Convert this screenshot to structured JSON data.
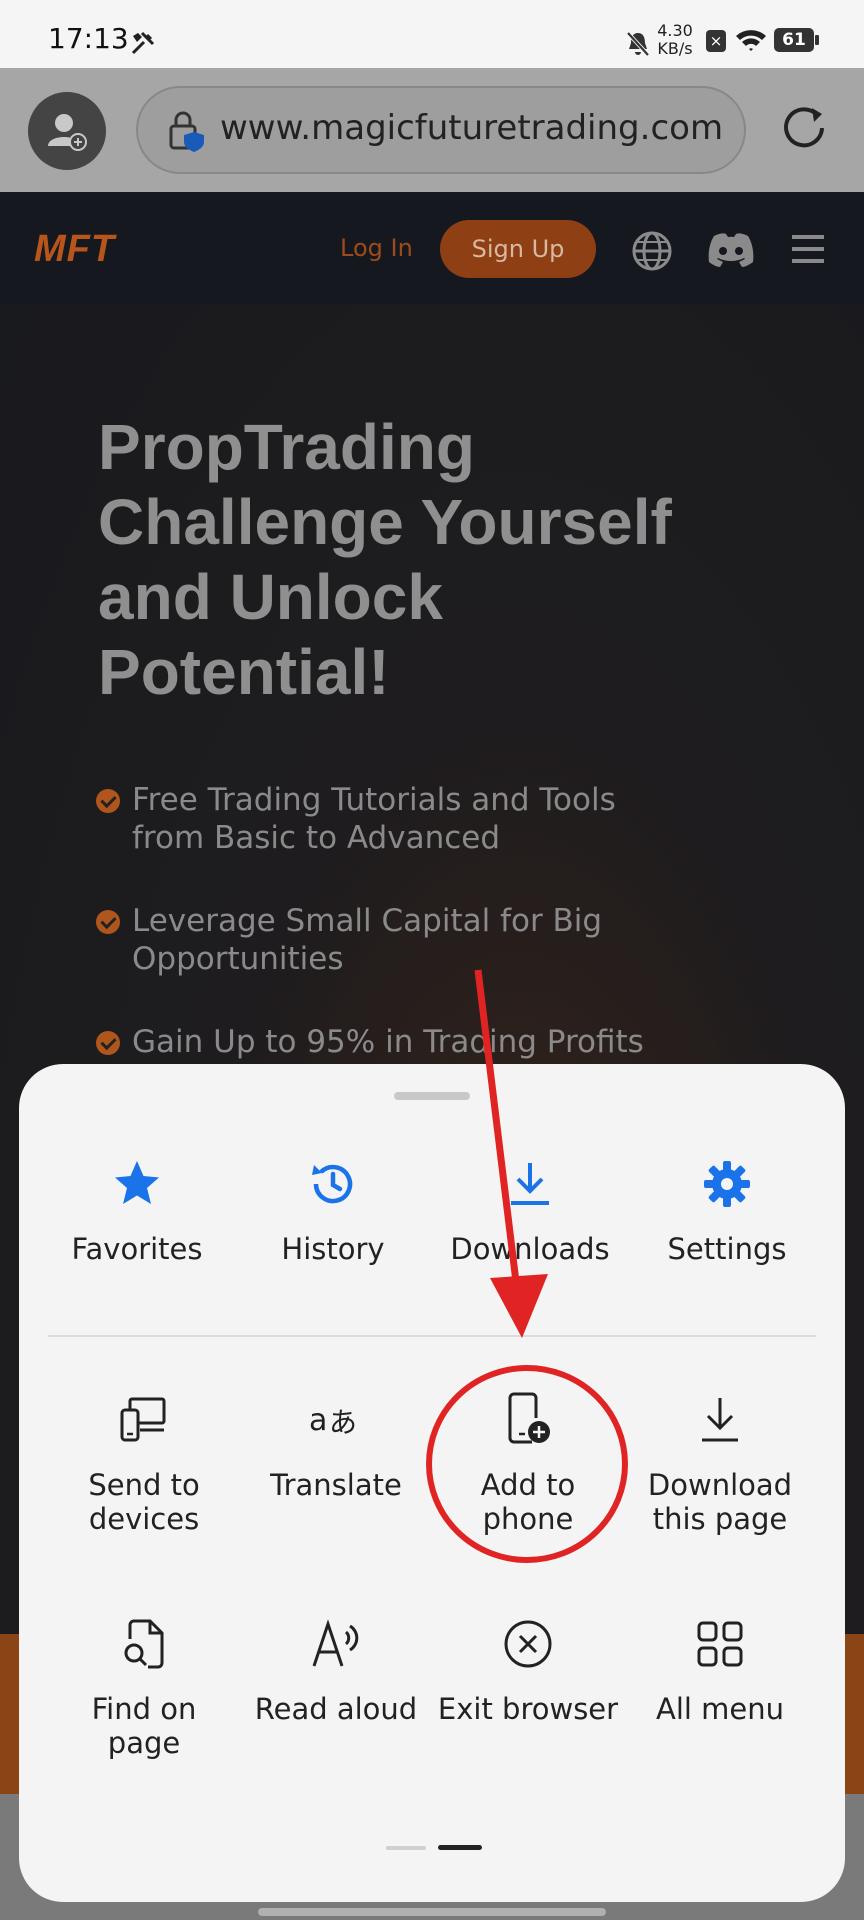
{
  "status_bar": {
    "time": "17:13",
    "net_speed_value": "4.30",
    "net_speed_unit": "KB/s",
    "battery": "61"
  },
  "browser": {
    "url": "www.magicfuturetrading.com"
  },
  "site": {
    "logo": "MFT",
    "login_label": "Log In",
    "signup_label": "Sign Up",
    "headline": [
      "PropTrading",
      "Challenge Yourself",
      "and Unlock",
      "Potential!"
    ],
    "bullets": [
      [
        "Free Trading Tutorials and Tools",
        "from Basic to Advanced"
      ],
      [
        "Leverage Small Capital for Big",
        "Opportunities"
      ],
      [
        "Gain Up to 95% in Trading Profits"
      ]
    ]
  },
  "menu": {
    "quick_actions": [
      {
        "label": "Favorites",
        "icon": "star-icon"
      },
      {
        "label": "History",
        "icon": "history-icon"
      },
      {
        "label": "Downloads",
        "icon": "download-icon"
      },
      {
        "label": "Settings",
        "icon": "gear-icon"
      }
    ],
    "items": [
      {
        "label": [
          "Send to",
          "devices"
        ],
        "icon": "send-to-devices-icon"
      },
      {
        "label": [
          "Translate"
        ],
        "icon": "translate-icon"
      },
      {
        "label": [
          "Add to",
          "phone"
        ],
        "icon": "add-to-phone-icon"
      },
      {
        "label": [
          "Download",
          "this page"
        ],
        "icon": "download-page-icon"
      },
      {
        "label": [
          "Find on",
          "page"
        ],
        "icon": "find-on-page-icon"
      },
      {
        "label": [
          "Read aloud"
        ],
        "icon": "read-aloud-icon"
      },
      {
        "label": [
          "Exit browser"
        ],
        "icon": "exit-icon"
      },
      {
        "label": [
          "All menu"
        ],
        "icon": "grid-icon"
      }
    ]
  },
  "colors": {
    "accent_blue": "#1a73e8",
    "annotation_red": "#e02424",
    "brand_orange": "#b8551a"
  }
}
